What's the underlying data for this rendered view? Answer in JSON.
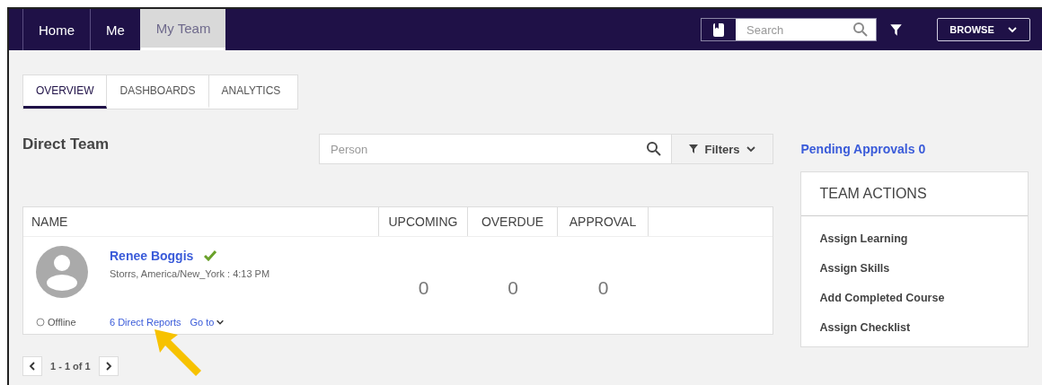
{
  "nav": {
    "items": [
      {
        "label": "Home",
        "selected": false
      },
      {
        "label": "Me",
        "selected": false
      },
      {
        "label": "My Team",
        "selected": true
      }
    ],
    "search": {
      "placeholder": "Search"
    },
    "browse": "BROWSE"
  },
  "tabs": [
    {
      "label": "OVERVIEW",
      "selected": true
    },
    {
      "label": "DASHBOARDS",
      "selected": false
    },
    {
      "label": "ANALYTICS",
      "selected": false
    }
  ],
  "section_title": "Direct Team",
  "person_search": {
    "placeholder": "Person"
  },
  "filters": "Filters",
  "table": {
    "columns": [
      "NAME",
      "UPCOMING",
      "OVERDUE",
      "APPROVAL"
    ],
    "rows": [
      {
        "name": "Renee Boggis",
        "verified": true,
        "location": "Storrs, America/New_York : 4:13 PM",
        "status": "Offline",
        "online": false,
        "direct_reports": "6 Direct Reports",
        "goto": "Go to",
        "values": [
          "0",
          "0",
          "0"
        ]
      }
    ]
  },
  "pagination": "1 - 1 of 1",
  "pending_approvals": "Pending Approvals 0",
  "team_actions": {
    "title": "TEAM ACTIONS",
    "items": [
      "Assign Learning",
      "Assign Skills",
      "Add Completed Course",
      "Assign Checklist"
    ]
  },
  "annotation_arrow": true
}
